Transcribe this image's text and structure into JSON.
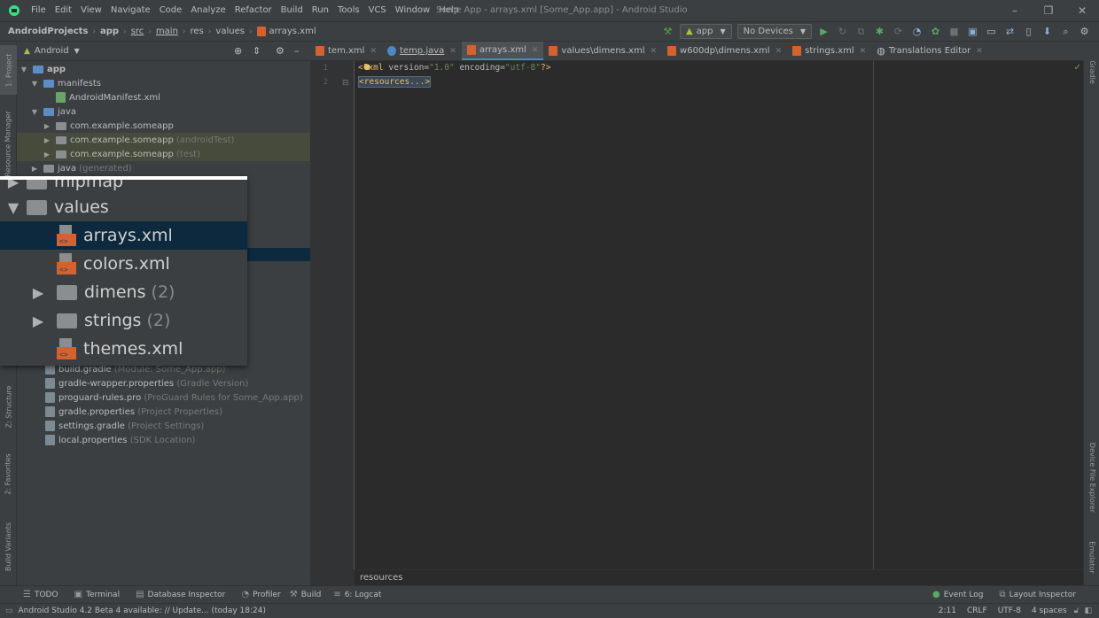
{
  "window": {
    "title": "Some App - arrays.xml [Some_App.app] - Android Studio",
    "menu": [
      "File",
      "Edit",
      "View",
      "Navigate",
      "Code",
      "Analyze",
      "Refactor",
      "Build",
      "Run",
      "Tools",
      "VCS",
      "Window",
      "Help"
    ]
  },
  "navbar": {
    "crumbs": [
      "AndroidProjects",
      "app",
      "src",
      "main",
      "res",
      "values",
      "arrays.xml"
    ],
    "run_config": "app",
    "device": "No Devices"
  },
  "project_panel": {
    "view_mode": "Android",
    "tree": [
      {
        "label": "app",
        "hint": ""
      },
      {
        "label": "manifests",
        "hint": ""
      },
      {
        "label": "AndroidManifest.xml",
        "hint": ""
      },
      {
        "label": "java",
        "hint": ""
      },
      {
        "label": "com.example.someapp",
        "hint": ""
      },
      {
        "label": "com.example.someapp",
        "hint": "(androidTest)"
      },
      {
        "label": "com.example.someapp",
        "hint": "(test)"
      },
      {
        "label": "java",
        "hint": "(generated)"
      }
    ],
    "gradle_tree": [
      {
        "label": "build.gradle",
        "hint": "(Module: Some_App.app)"
      },
      {
        "label": "gradle-wrapper.properties",
        "hint": "(Gradle Version)"
      },
      {
        "label": "proguard-rules.pro",
        "hint": "(ProGuard Rules for Some_App.app)"
      },
      {
        "label": "gradle.properties",
        "hint": "(Project Properties)"
      },
      {
        "label": "settings.gradle",
        "hint": "(Project Settings)"
      },
      {
        "label": "local.properties",
        "hint": "(SDK Location)"
      }
    ]
  },
  "zoom": {
    "partial_top": "mipmap",
    "values_folder": "values",
    "files": [
      {
        "label": "arrays.xml",
        "count": ""
      },
      {
        "label": "colors.xml",
        "count": ""
      },
      {
        "label": "dimens",
        "count": "(2)"
      },
      {
        "label": "strings",
        "count": "(2)"
      },
      {
        "label": "themes.xml",
        "count": ""
      }
    ]
  },
  "editor": {
    "tabs": [
      "tem.xml",
      "temp.java",
      "arrays.xml",
      "values\\dimens.xml",
      "w600dp\\dimens.xml",
      "strings.xml",
      "Translations Editor"
    ],
    "active_tab": 2,
    "line_numbers": [
      "1",
      "2"
    ],
    "code": {
      "l1_open": "<?",
      "l1_tag": "xml",
      "l1_attr1": " version=",
      "l1_val1": "\"1.0\"",
      "l1_attr2": " encoding=",
      "l1_val2": "\"utf-8\"",
      "l1_close": "?>",
      "l2": "<resources...>"
    },
    "breadcrumb": "resources"
  },
  "left_strip": [
    "1: Project",
    "Resource Manager",
    "Z: Structure",
    "2: Favorites",
    "Build Variants"
  ],
  "right_strip": [
    "Gradle",
    "Device File Explorer",
    "Emulator"
  ],
  "tool_windows": {
    "left": [
      "TODO",
      "Terminal",
      "Database Inspector",
      "Profiler",
      "Build",
      "6: Logcat"
    ],
    "right": [
      "Event Log",
      "Layout Inspector"
    ]
  },
  "status": {
    "message": "Android Studio 4.2 Beta 4 available: // Update... (today 18:24)",
    "position": "2:11",
    "line_sep": "CRLF",
    "encoding": "UTF-8",
    "indent": "4 spaces"
  },
  "colors": {
    "accent": "#4a88c7",
    "selection": "#0d293e",
    "xml_file": "#d4622f",
    "android_green": "#a4c639"
  }
}
